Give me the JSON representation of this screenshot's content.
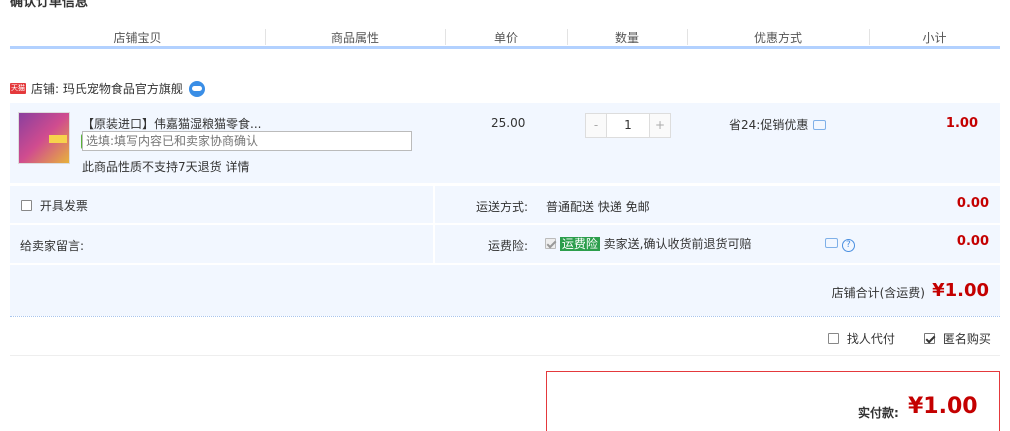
{
  "section_title": "确认订单信息",
  "columns": [
    "店铺宝贝",
    "商品属性",
    "单价",
    "数量",
    "优惠方式",
    "小计"
  ],
  "shop": {
    "badge": "天猫",
    "label": "店铺: 玛氏宠物食品官方旗舰"
  },
  "item": {
    "title": "【原装进口】伟嘉猫湿粮猫零食...",
    "note": "此商品性质不支持7天退货 详情",
    "price": "25.00",
    "quantity": "1",
    "qty_minus": "-",
    "qty_plus": "+",
    "discount": "省24:促销优惠",
    "subtotal": "1.00"
  },
  "invoice": {
    "label": "开具发票"
  },
  "shipping": {
    "label": "运送方式:",
    "value": "普通配送 快递 免邮",
    "amount": "0.00"
  },
  "memo": {
    "label": "给卖家留言:",
    "placeholder": "选填:填写内容已和卖家协商确认"
  },
  "insurance": {
    "label": "运费险:",
    "tag": "运费险",
    "text": "卖家送,确认收货前退货可赔",
    "help": "?",
    "amount": "0.00"
  },
  "shop_total": {
    "label": "店铺合计(含运费)",
    "amount": "¥1.00"
  },
  "options": {
    "proxy_label": "找人代付",
    "anonymous_label": "匿名购买"
  },
  "pay": {
    "label": "实付款:",
    "amount": "¥1.00"
  }
}
